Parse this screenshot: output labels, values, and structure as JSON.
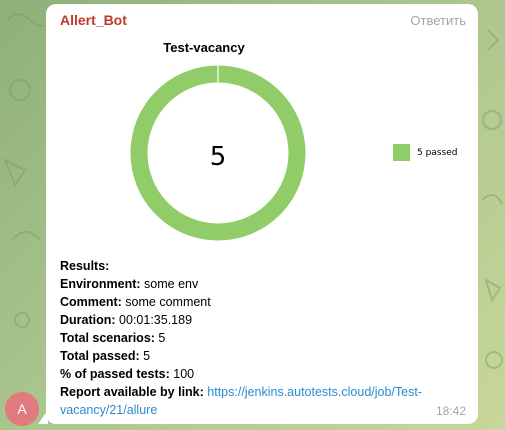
{
  "message": {
    "sender": "Allert_Bot",
    "reply_label": "Ответить",
    "time": "18:42",
    "avatar_letter": "A"
  },
  "chart_data": {
    "type": "pie",
    "title": "Test-vacancy",
    "center_label": "5",
    "slices": [
      {
        "name": "5 passed",
        "value": 5,
        "color": "#90cc68"
      }
    ],
    "legend": [
      "5 passed"
    ],
    "legend_position": "right"
  },
  "results": {
    "heading": "Results:",
    "environment_label": "Environment:",
    "environment_value": " some env",
    "comment_label": "Comment:",
    "comment_value": " some comment",
    "duration_label": "Duration:",
    "duration_value": " 00:01:35.189",
    "scenarios_label": "Total scenarios:",
    "scenarios_value": " 5",
    "passed_label": "Total passed:",
    "passed_value": " 5",
    "percent_label": "% of passed tests:",
    "percent_value": " 100",
    "report_label": "Report available by link:",
    "report_link": "https://jenkins.autotests.cloud/job/Test-vacancy/21/allure"
  },
  "colors": {
    "sender": "#c0392b",
    "link": "#2a8bd0",
    "chart": "#90cc68",
    "avatar": "#e07a7f"
  }
}
